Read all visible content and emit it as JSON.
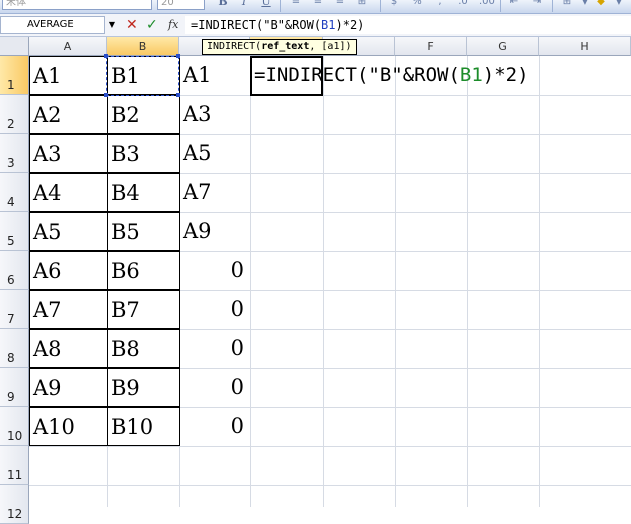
{
  "toolbar": {
    "font_name": "宋体",
    "font_size": "20",
    "bold": "B",
    "italic": "I",
    "underline": "U"
  },
  "formula_bar": {
    "name_box": "AVERAGE",
    "cancel": "✕",
    "enter": "✓",
    "fx": "fx",
    "formula_prefix": "=INDIRECT(\"B\"&ROW(",
    "formula_ref": "B1",
    "formula_suffix": ")*2)"
  },
  "tooltip": {
    "func": "INDIRECT(",
    "arg1": "ref_text",
    "rest": ", [a1])"
  },
  "columns": [
    "A",
    "B",
    "",
    "",
    "",
    "F",
    "G",
    "H"
  ],
  "rows": [
    "1",
    "2",
    "3",
    "4",
    "5",
    "6",
    "7",
    "8",
    "9",
    "10",
    "11",
    "12"
  ],
  "cells": {
    "A": [
      "A1",
      "A2",
      "A3",
      "A4",
      "A5",
      "A6",
      "A7",
      "A8",
      "A9",
      "A10"
    ],
    "B": [
      "B1",
      "B2",
      "B3",
      "B4",
      "B5",
      "B6",
      "B7",
      "B8",
      "B9",
      "B10"
    ],
    "C": [
      "A1",
      "A3",
      "A5",
      "A7",
      "A9",
      "0",
      "0",
      "0",
      "0",
      "0"
    ],
    "D1": "=INDIRECT(\"B\"&ROW(B1)*2)",
    "D1_prefix": "=INDIRECT(\"B\"&ROW(",
    "D1_ref": "B1",
    "D1_suffix": ")*2)"
  },
  "colors": {
    "ref_highlight": "#1f3fbf",
    "formula_ref_green": "#1c8c2a",
    "active_header": "#f9c964"
  }
}
